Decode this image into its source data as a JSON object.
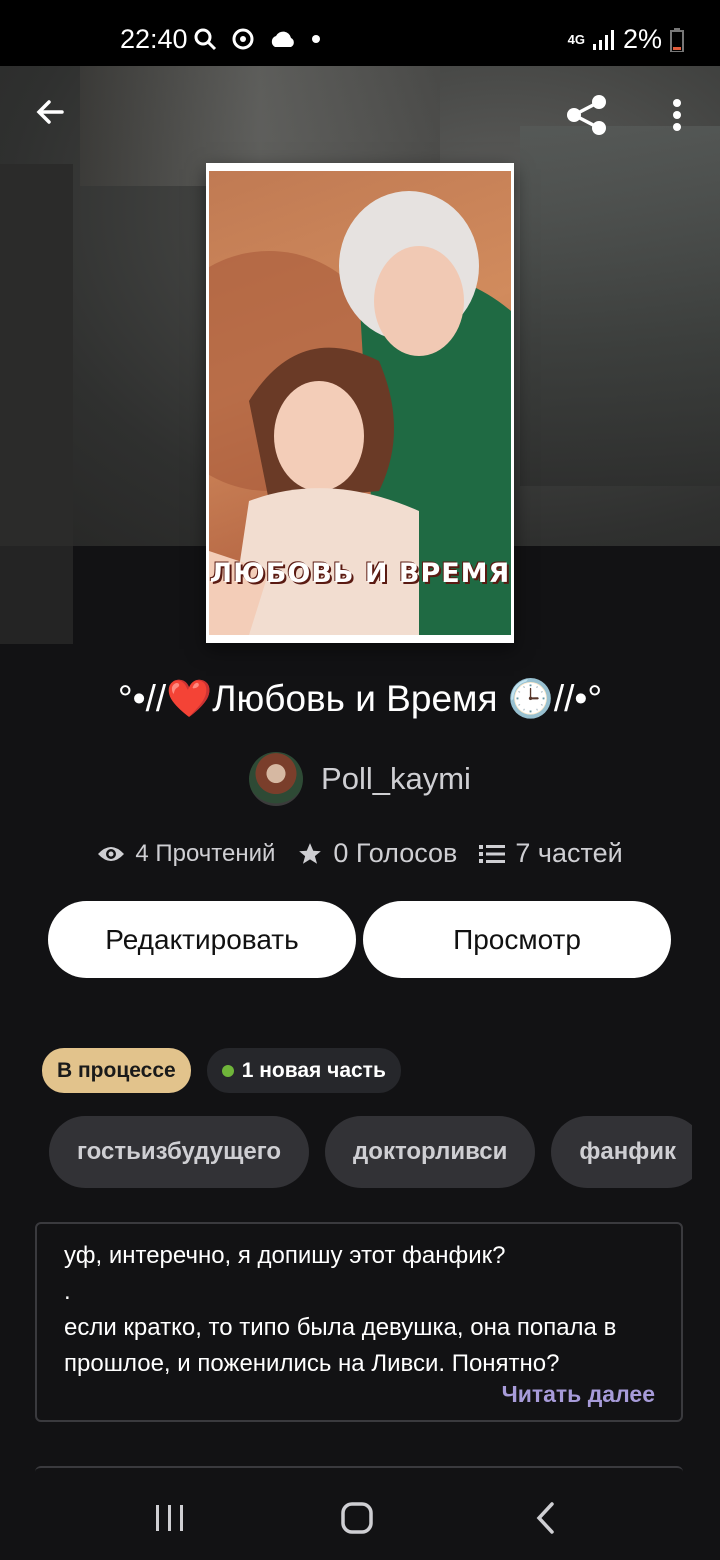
{
  "status_bar": {
    "time": "22:40",
    "icons_left": [
      "search-icon",
      "sync-icon",
      "cloud-icon",
      "dot-icon"
    ],
    "network": "4G",
    "battery": "2%"
  },
  "top_bar": {
    "back_icon": "arrow-left-icon",
    "share_icon": "share-icon",
    "menu_icon": "more-vert-icon"
  },
  "cover": {
    "title_text": "ЛЮБОВЬ И ВРЕМЯ"
  },
  "story": {
    "title": "°•//❤️Любовь и Время 🕒//•°",
    "author": "Poll_kaymi",
    "stats": {
      "reads": "4 Прочтений",
      "votes": "0 Голосов",
      "parts": "7 частей"
    }
  },
  "actions": {
    "edit_label": "Редактировать",
    "preview_label": "Просмотр"
  },
  "badges": {
    "status": "В процессе",
    "new_part": "1 новая часть"
  },
  "tags": [
    "гостьизбудущего",
    "докторливси",
    "фанфик"
  ],
  "description": {
    "text": "уф, интеречно, я допишу этот фанфик?\n.\nесли кратко, то типо была девушка, она попала в прошлое, и поженились на Ливси. Понятно?",
    "read_more": "Читать далее"
  },
  "nav": [
    "recents-icon",
    "home-icon",
    "back-icon"
  ],
  "colors": {
    "background": "#121214",
    "status_badge": "#e2c38c",
    "accent_link": "#a79bd9",
    "new_dot": "#6fb53a"
  }
}
